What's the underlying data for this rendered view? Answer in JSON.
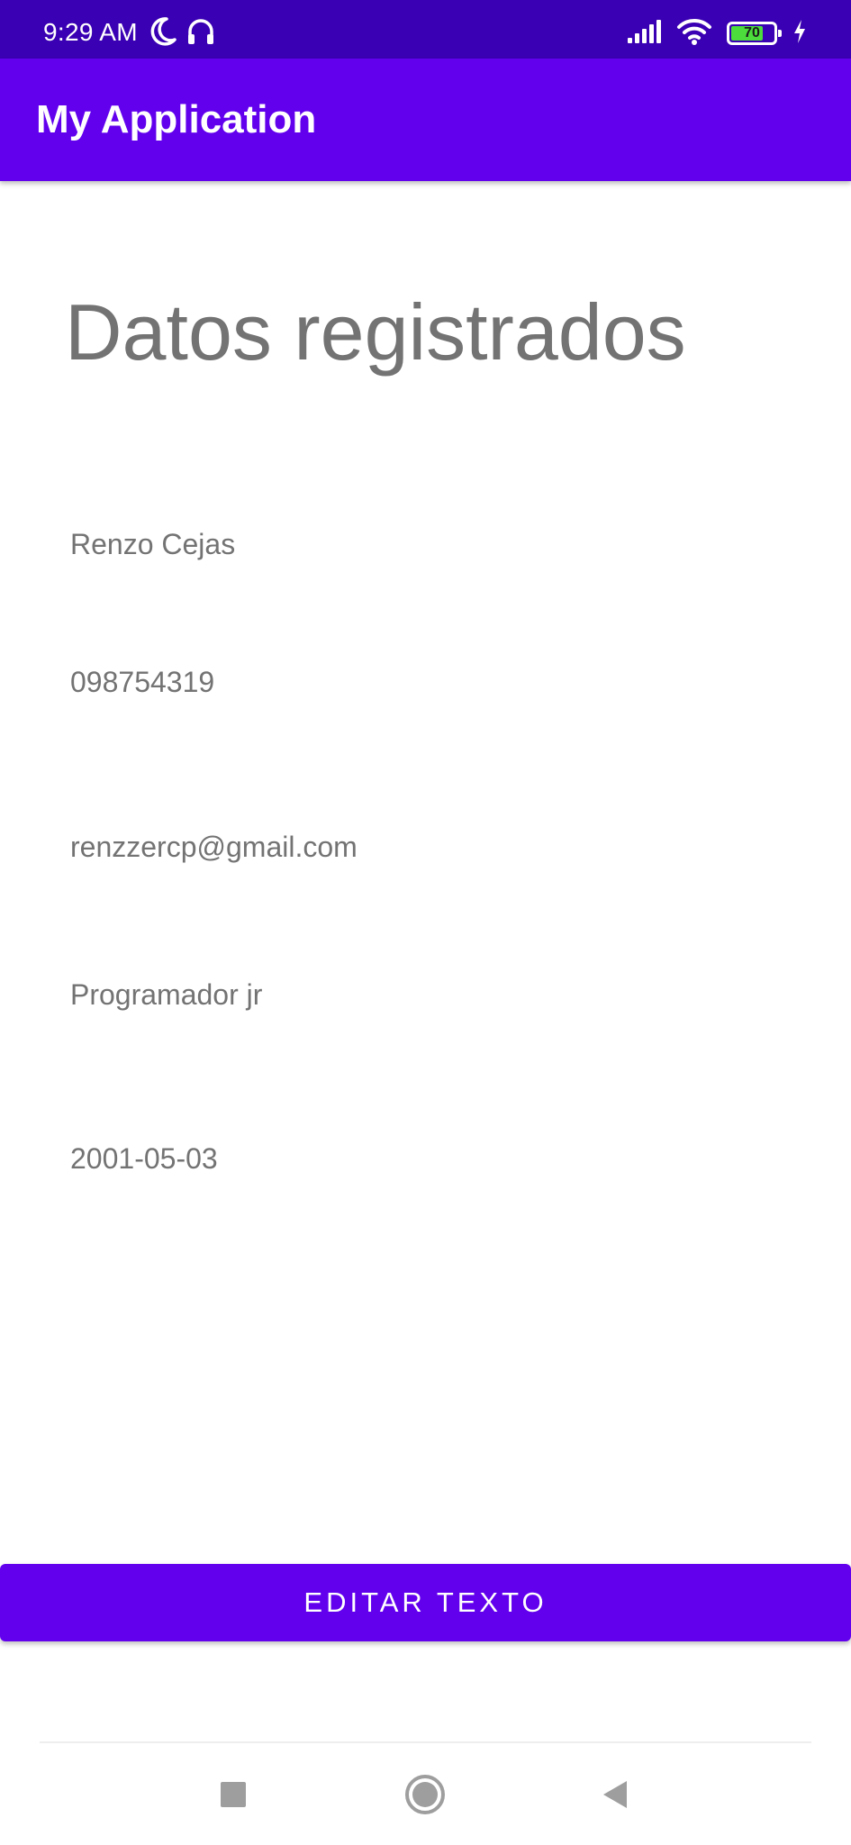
{
  "status_bar": {
    "time": "9:29 AM",
    "left_icons": [
      "moon-icon",
      "headphones-icon"
    ],
    "right_icons": [
      "signal-icon",
      "wifi-icon",
      "battery-icon",
      "charging-icon"
    ],
    "battery_level": "70",
    "background_color": "#3a00b3"
  },
  "app_bar": {
    "title": "My Application",
    "background_color": "#6200ee"
  },
  "content": {
    "heading": "Datos registrados",
    "name": "Renzo Cejas",
    "phone": "098754319",
    "email": "renzzercp@gmail.com",
    "occupation": "Programador jr",
    "birth_date": "2001-05-03",
    "text_color": "#737373"
  },
  "actions": {
    "edit_button_label": "EDITAR TEXTO",
    "accent_color": "#6200ee"
  },
  "navigation_bar": {
    "buttons": [
      "recents-square-icon",
      "home-circle-icon",
      "back-triangle-icon"
    ]
  }
}
